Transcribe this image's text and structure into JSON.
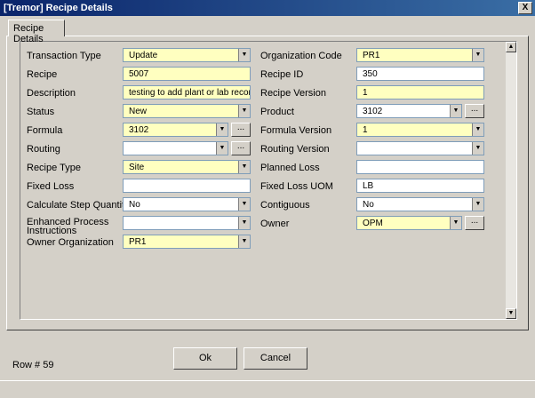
{
  "window": {
    "title": "[Tremor] Recipe Details",
    "close_glyph": "X"
  },
  "tab": {
    "label": "Recipe Details"
  },
  "left": [
    {
      "label": "Transaction Type",
      "value": "Update",
      "required": true,
      "dropdown": true,
      "ellipsis": false
    },
    {
      "label": "Recipe",
      "value": "5007",
      "required": true,
      "dropdown": false,
      "ellipsis": false
    },
    {
      "label": "Description",
      "value": "testing to add plant or lab record",
      "required": true,
      "dropdown": false,
      "ellipsis": false
    },
    {
      "label": "Status",
      "value": "New",
      "required": true,
      "dropdown": true,
      "ellipsis": false
    },
    {
      "label": "Formula",
      "value": "3102",
      "required": true,
      "dropdown": true,
      "ellipsis": true
    },
    {
      "label": "Routing",
      "value": "",
      "required": false,
      "dropdown": true,
      "ellipsis": true
    },
    {
      "label": "Recipe Type",
      "value": "Site",
      "required": true,
      "dropdown": true,
      "ellipsis": false
    },
    {
      "label": "Fixed Loss",
      "value": "",
      "required": false,
      "dropdown": false,
      "ellipsis": false
    },
    {
      "label": "Calculate Step Quantity",
      "value": "No",
      "required": false,
      "dropdown": true,
      "ellipsis": false
    },
    {
      "label": "Enhanced Process Instructions",
      "value": "",
      "required": false,
      "dropdown": true,
      "ellipsis": false
    },
    {
      "label": "Owner Organization",
      "value": "PR1",
      "required": true,
      "dropdown": true,
      "ellipsis": false
    }
  ],
  "right": [
    {
      "label": "Organization Code",
      "value": "PR1",
      "required": true,
      "dropdown": true,
      "ellipsis": false
    },
    {
      "label": "Recipe ID",
      "value": "350",
      "required": false,
      "dropdown": false,
      "ellipsis": false
    },
    {
      "label": "Recipe Version",
      "value": "1",
      "required": true,
      "dropdown": false,
      "ellipsis": false
    },
    {
      "label": "Product",
      "value": "3102",
      "required": false,
      "dropdown": true,
      "ellipsis": true
    },
    {
      "label": "Formula Version",
      "value": "1",
      "required": true,
      "dropdown": true,
      "ellipsis": false
    },
    {
      "label": "Routing Version",
      "value": "",
      "required": false,
      "dropdown": true,
      "ellipsis": false
    },
    {
      "label": "Planned Loss",
      "value": "",
      "required": false,
      "dropdown": false,
      "ellipsis": false
    },
    {
      "label": "Fixed Loss UOM",
      "value": "LB",
      "required": false,
      "dropdown": false,
      "ellipsis": false
    },
    {
      "label": "Contiguous",
      "value": "No",
      "required": false,
      "dropdown": true,
      "ellipsis": false
    },
    {
      "label": "Owner",
      "value": "OPM",
      "required": true,
      "dropdown": true,
      "ellipsis": true
    }
  ],
  "footer": {
    "row_label": "Row # 59",
    "ok_label": "Ok",
    "cancel_label": "Cancel"
  },
  "glyphs": {
    "ellipsis": "...",
    "dropdown": "▼",
    "scroll_up": "▲",
    "scroll_down": "▼"
  }
}
